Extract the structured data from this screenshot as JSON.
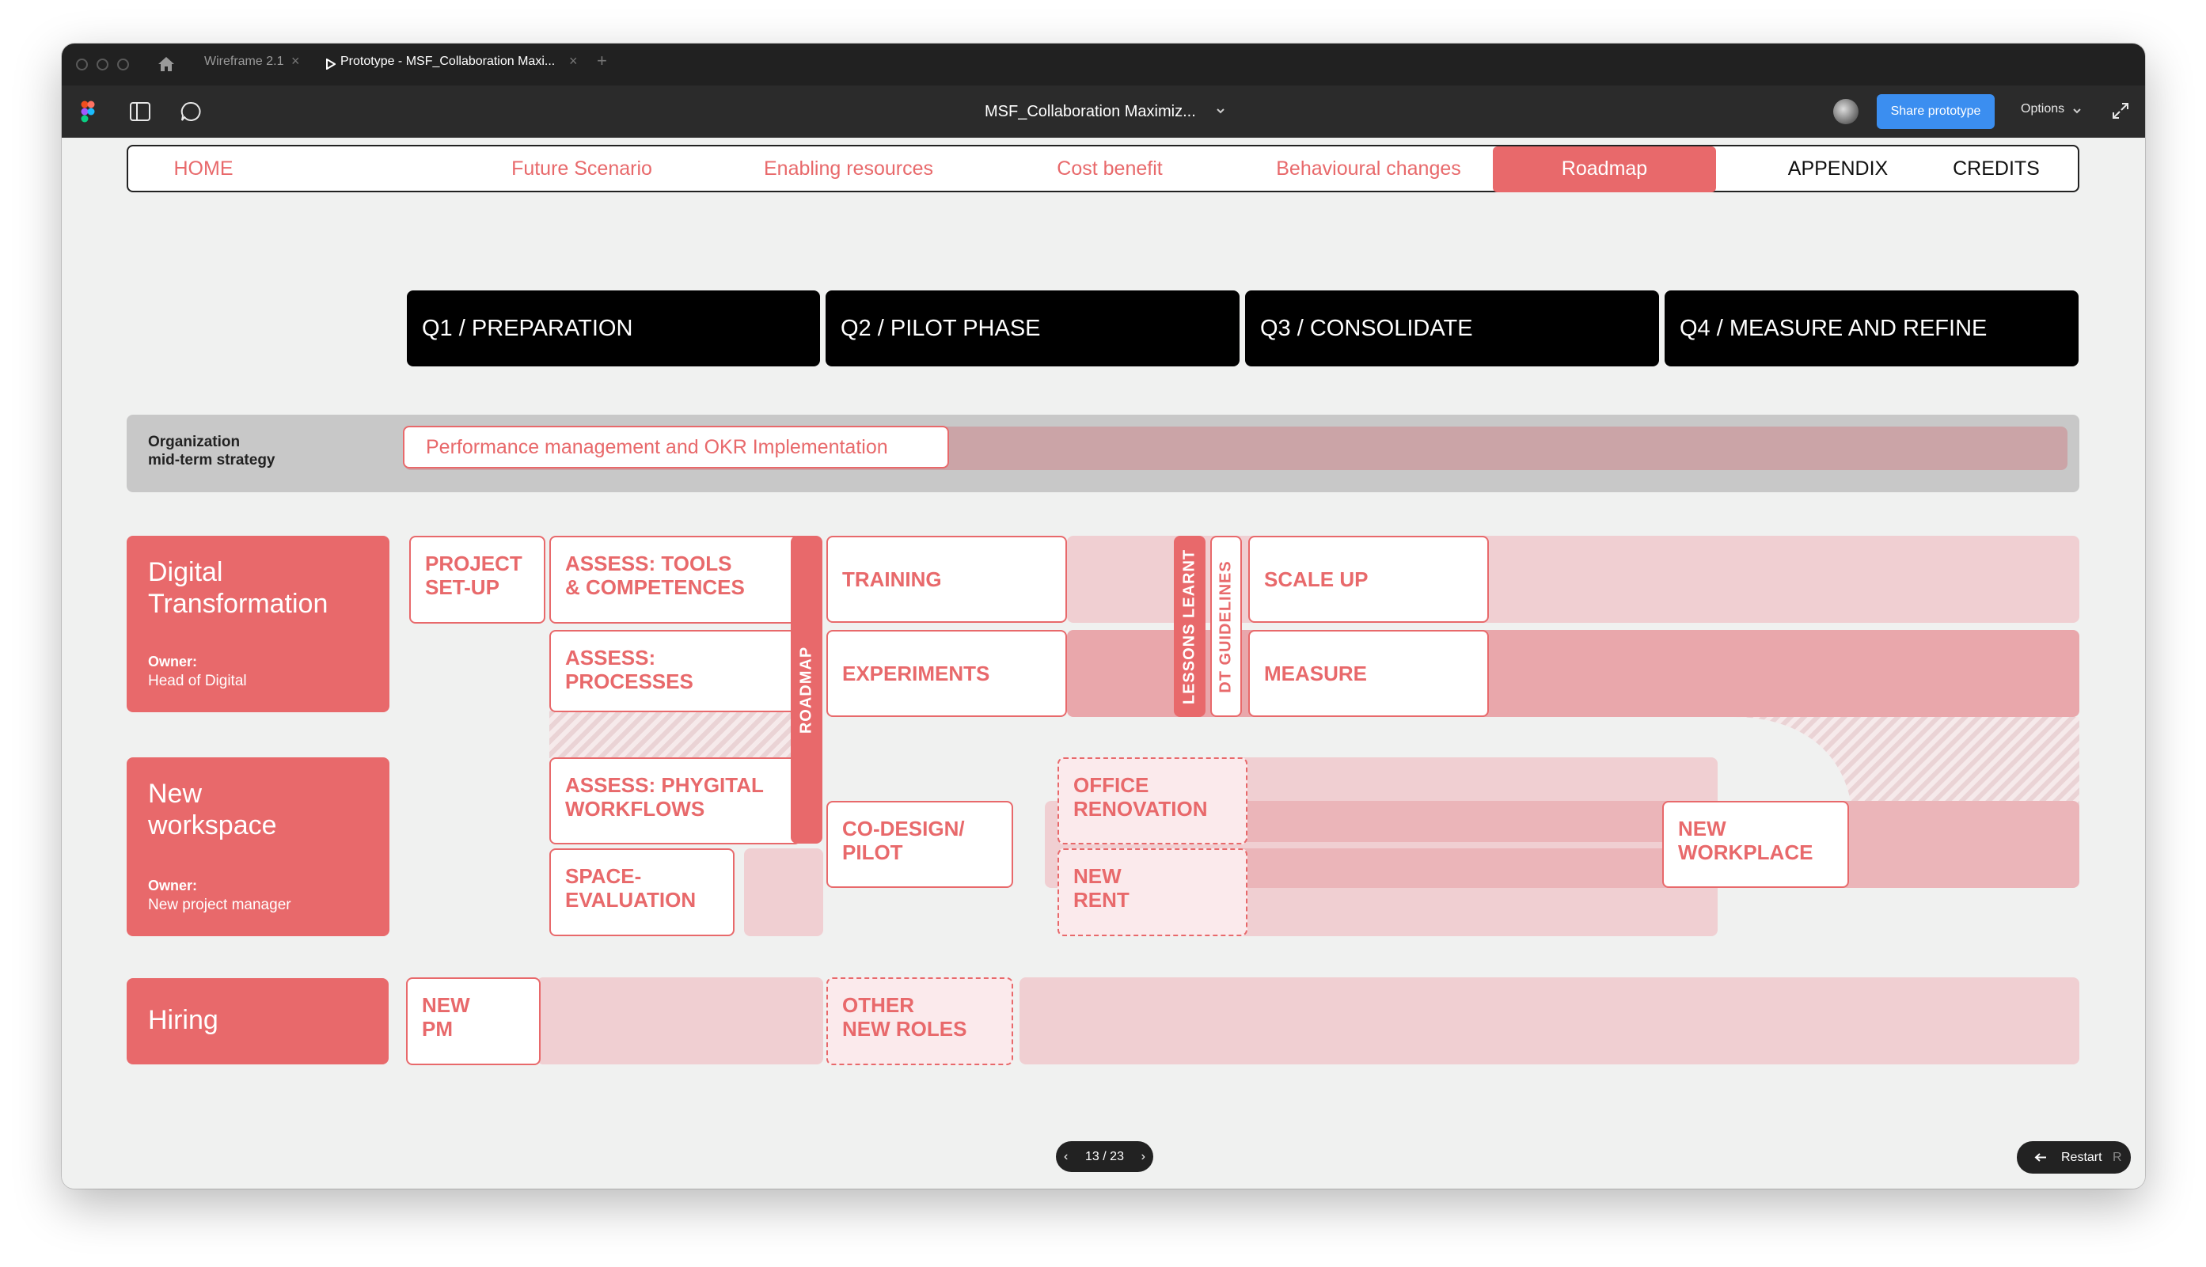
{
  "browser": {
    "tabs": [
      {
        "label": "Wireframe 2.1"
      },
      {
        "label": "Prototype - MSF_Collaboration Maxi..."
      }
    ],
    "new_tab": "+"
  },
  "toolbar": {
    "file_title": "MSF_Collaboration Maximiz...",
    "share_label": "Share prototype",
    "options_label": "Options"
  },
  "nav": {
    "items": [
      "HOME",
      "Future Scenario",
      "Enabling resources",
      "Cost benefit",
      "Behavioural changes",
      "Roadmap",
      "APPENDIX",
      "CREDITS"
    ]
  },
  "quarters": [
    "Q1 / PREPARATION",
    "Q2 / PILOT PHASE",
    "Q3 / CONSOLIDATE",
    "Q4 / MEASURE AND REFINE"
  ],
  "org": {
    "label_line1": "Organization",
    "label_line2": "mid-term strategy",
    "okr": "Performance management and OKR Implementation"
  },
  "owners": {
    "digital": {
      "title1": "Digital",
      "title2": "Transformation",
      "owner_label": "Owner:",
      "owner_value": "Head of Digital"
    },
    "workspace": {
      "title1": "New",
      "title2": "workspace",
      "owner_label": "Owner:",
      "owner_value": "New project manager"
    },
    "hiring": {
      "title": "Hiring"
    }
  },
  "tasks": {
    "project_setup": [
      "PROJECT",
      "SET-UP"
    ],
    "assess_tools": [
      "ASSESS: TOOLS",
      "& COMPETENCES"
    ],
    "assess_processes": [
      "ASSESS:",
      "PROCESSES"
    ],
    "assess_phygital": [
      "ASSESS: PHYGITAL",
      "WORKFLOWS"
    ],
    "space_evaluation": [
      "SPACE-",
      "EVALUATION"
    ],
    "training": "TRAINING",
    "experiments": "EXPERIMENTS",
    "codesign": [
      "CO-DESIGN/",
      "PILOT"
    ],
    "office_renovation": [
      "OFFICE",
      "RENOVATION"
    ],
    "new_rent": [
      "NEW",
      "RENT"
    ],
    "scale_up": "SCALE UP",
    "measure": "MEASURE",
    "new_workplace": [
      "NEW",
      "WORKPLACE"
    ],
    "new_pm": [
      "NEW",
      "PM"
    ],
    "other_roles": [
      "OTHER",
      "NEW ROLES"
    ]
  },
  "vertical_bars": {
    "roadmap": "ROADMAP",
    "lessons": "LESSONS LEARNT",
    "dt_guidelines": "DT GUIDELINES"
  },
  "pager": {
    "label": "13 / 23"
  },
  "restart": {
    "label": "Restart",
    "shortcut": "R"
  },
  "colors": {
    "accent": "#e8696b",
    "band": "#f0cfd2",
    "chrome": "#2b2b2b",
    "share": "#3b8ef0"
  }
}
